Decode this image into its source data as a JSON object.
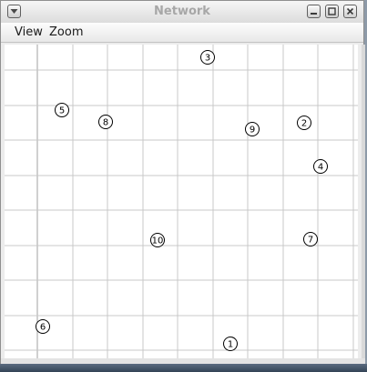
{
  "window": {
    "title": "Network"
  },
  "titlebar": {
    "icons": [
      "window-menu-icon",
      "minimize-icon",
      "maximize-icon",
      "close-icon"
    ]
  },
  "menubar": {
    "items": [
      {
        "label": "View"
      },
      {
        "label": "Zoom"
      }
    ]
  },
  "canvas": {
    "grid": true,
    "nodes": [
      {
        "label": "1"
      },
      {
        "label": "2"
      },
      {
        "label": "3"
      },
      {
        "label": "4"
      },
      {
        "label": "5"
      },
      {
        "label": "6"
      },
      {
        "label": "7"
      },
      {
        "label": "8"
      },
      {
        "label": "9"
      },
      {
        "label": "10"
      }
    ]
  },
  "colors": {
    "grid_line": "#c8c8c8",
    "canvas_bg": "#ffffff",
    "node_stroke": "#000000"
  }
}
